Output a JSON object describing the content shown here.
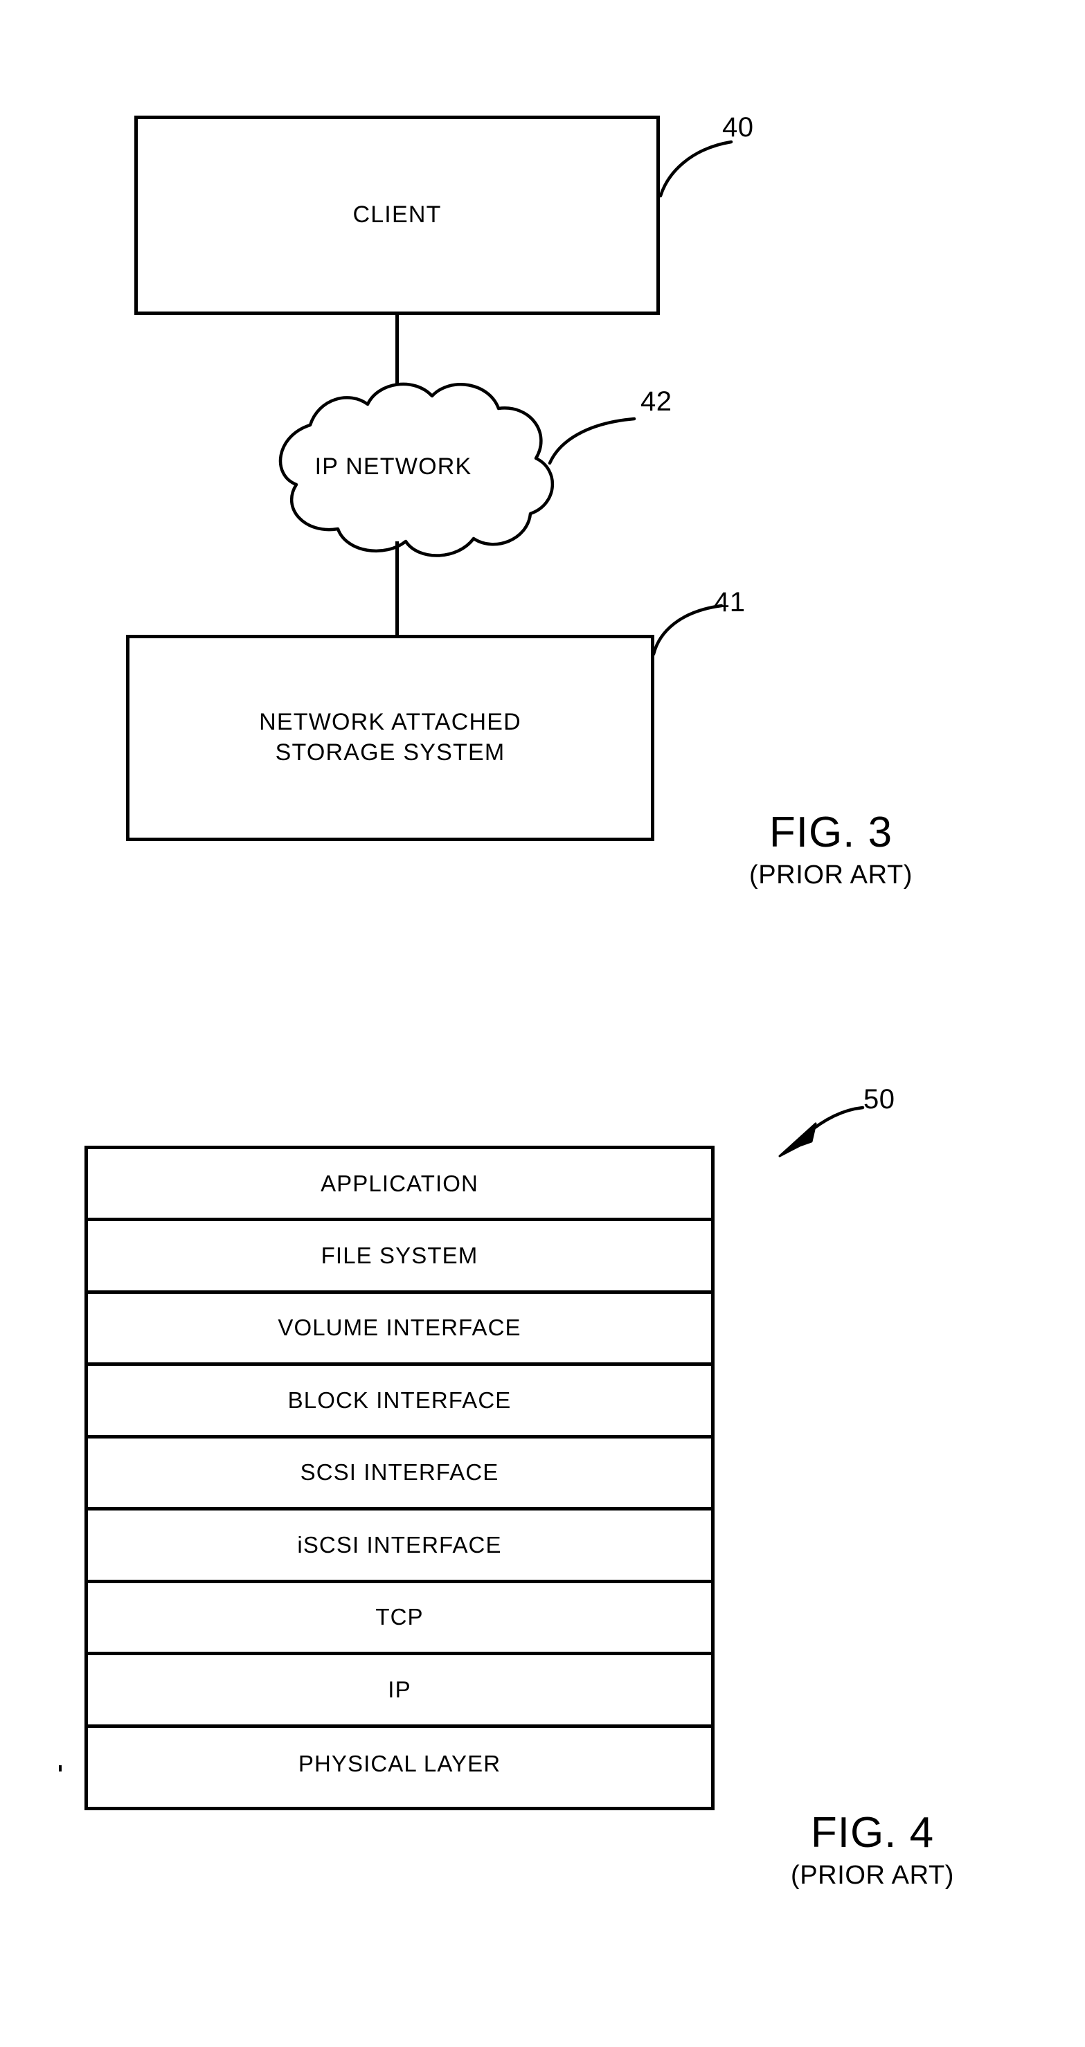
{
  "figures": [
    {
      "id": "fig3",
      "caption_title": "FIG. 3",
      "caption_sub": "(PRIOR ART)",
      "nodes": [
        {
          "name": "client",
          "label": "CLIENT",
          "ref": "40"
        },
        {
          "name": "ip-network",
          "label": "IP NETWORK",
          "ref": "42"
        },
        {
          "name": "nas",
          "label_line1": "NETWORK ATTACHED",
          "label_line2": "STORAGE SYSTEM",
          "ref": "41"
        }
      ]
    },
    {
      "id": "fig4",
      "caption_title": "FIG. 4",
      "caption_sub": "(PRIOR ART)",
      "ref": "50",
      "layers": [
        "APPLICATION",
        "FILE SYSTEM",
        "VOLUME INTERFACE",
        "BLOCK INTERFACE",
        "SCSI INTERFACE",
        "iSCSI INTERFACE",
        "TCP",
        "IP",
        "PHYSICAL LAYER"
      ]
    }
  ],
  "colors": {
    "ink": "#000000",
    "paper": "#ffffff"
  }
}
